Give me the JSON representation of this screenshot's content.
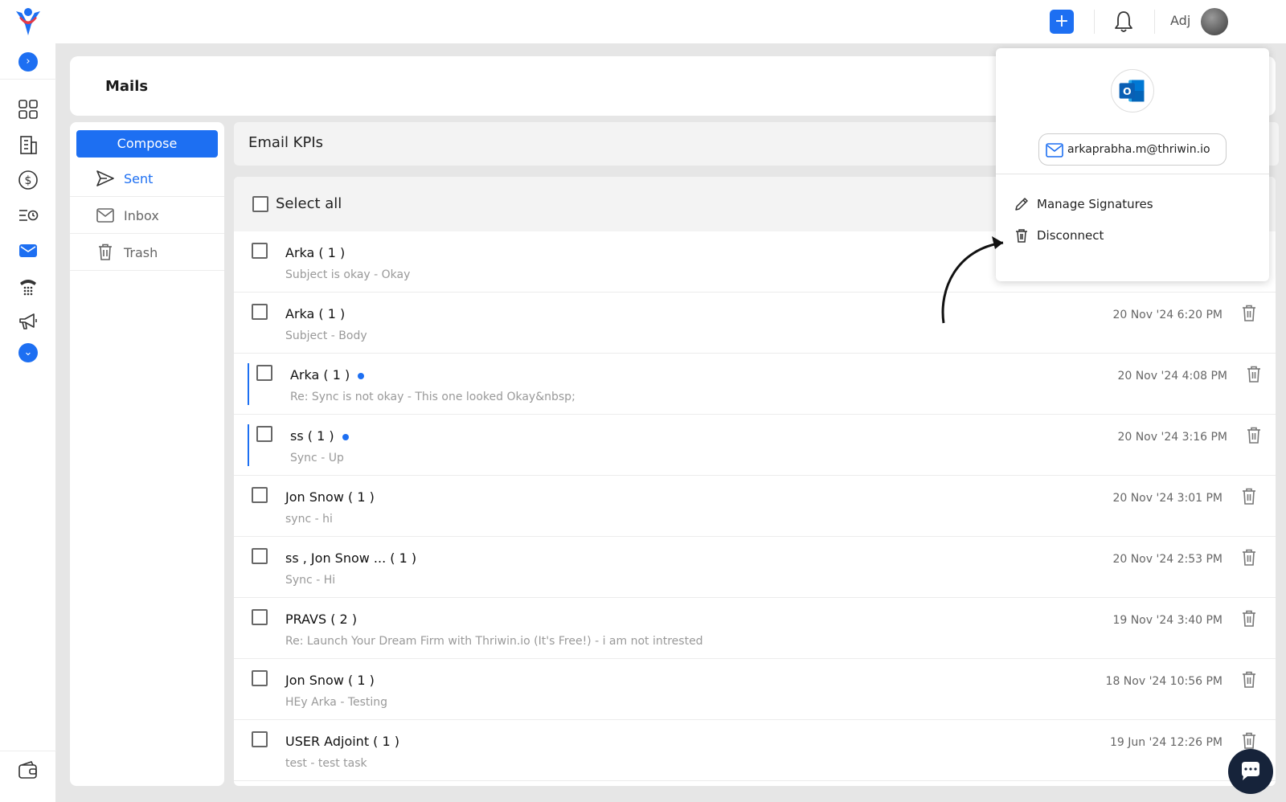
{
  "header": {
    "user_name": "Adj"
  },
  "page": {
    "title": "Mails"
  },
  "folders": {
    "compose_label": "Compose",
    "items": [
      {
        "label": "Sent",
        "icon": "send-icon",
        "active": true
      },
      {
        "label": "Inbox",
        "icon": "mail-icon",
        "active": false
      },
      {
        "label": "Trash",
        "icon": "trash-icon",
        "active": false
      }
    ]
  },
  "kpi": {
    "label": "Email KPIs"
  },
  "list": {
    "select_all_label": "Select all",
    "rows": [
      {
        "sender": "Arka ( 1 )",
        "preview": "Subject is okay -  Okay",
        "date": "",
        "unread": false
      },
      {
        "sender": "Arka ( 1 )",
        "preview": "Subject -  Body",
        "date": "20 Nov '24 6:20 PM",
        "unread": false
      },
      {
        "sender": "Arka ( 1 )",
        "preview": "Re: Sync is not okay -  This one looked Okay&nbsp;",
        "date": "20 Nov '24 4:08 PM",
        "unread": true
      },
      {
        "sender": "ss ( 1 )",
        "preview": "Sync -  Up",
        "date": "20 Nov '24 3:16 PM",
        "unread": true
      },
      {
        "sender": "Jon Snow ( 1 )",
        "preview": "sync -  hi",
        "date": "20 Nov '24 3:01 PM",
        "unread": false
      },
      {
        "sender": "ss ,   Jon Snow ... ( 1 )",
        "preview": "Sync -  Hi",
        "date": "20 Nov '24 2:53 PM",
        "unread": false
      },
      {
        "sender": "PRAVS ( 2 )",
        "preview": "Re: Launch Your Dream Firm with Thriwin.io (It's Free!) -  i am not intrested",
        "date": "19 Nov '24 3:40 PM",
        "unread": false
      },
      {
        "sender": "Jon Snow ( 1 )",
        "preview": "HEy Arka -  Testing",
        "date": "18 Nov '24 10:56 PM",
        "unread": false
      },
      {
        "sender": "USER Adjoint ( 1 )",
        "preview": "test -  test task",
        "date": "19 Jun '24 12:26 PM",
        "unread": false
      }
    ]
  },
  "dropdown": {
    "email": "arkaprabha.m@thriwin.io",
    "manage_signatures": "Manage Signatures",
    "disconnect": "Disconnect"
  },
  "colors": {
    "accent": "#1d6ff2",
    "chat_button": "#16233a"
  }
}
